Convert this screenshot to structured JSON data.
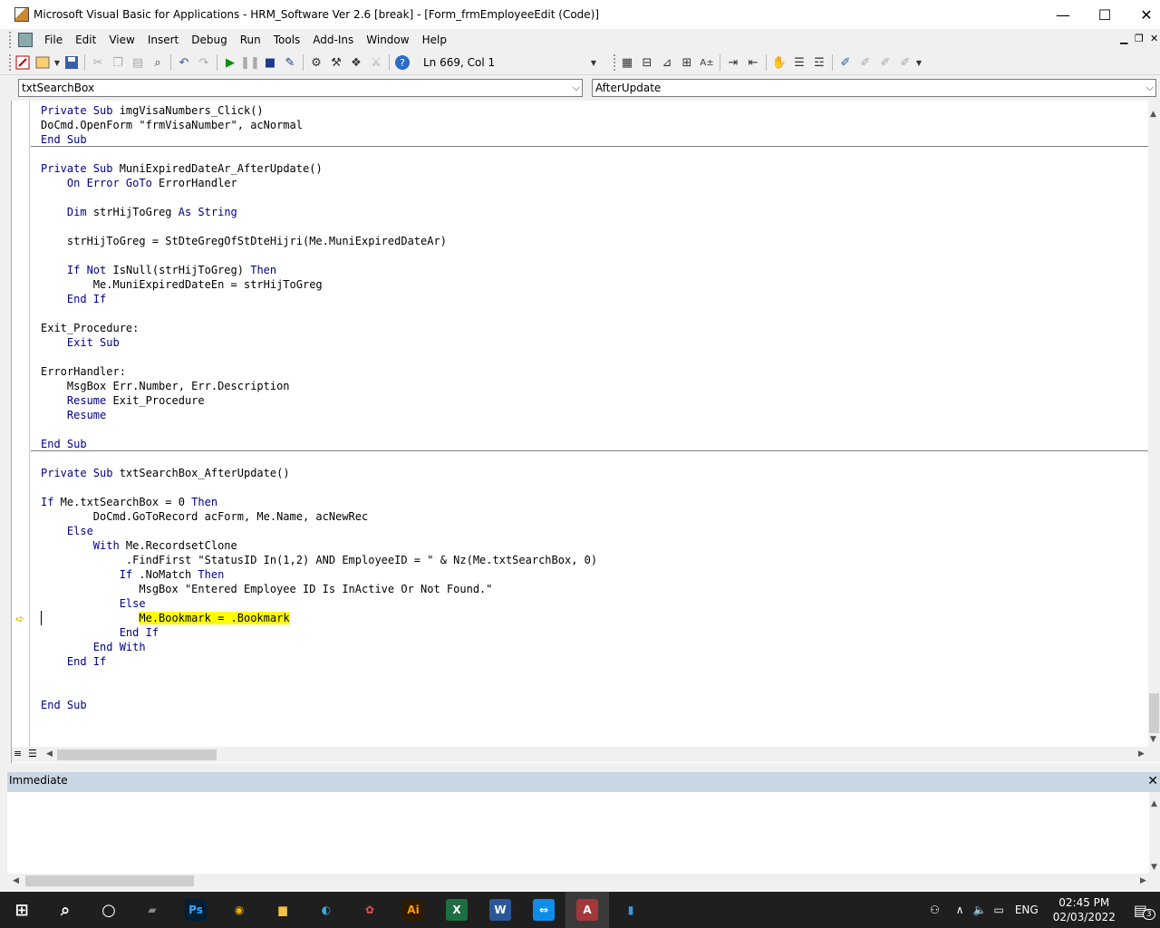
{
  "window": {
    "title": "Microsoft Visual Basic for Applications - HRM_Software Ver 2.6 [break] - [Form_frmEmployeeEdit (Code)]",
    "minimize_glyph": "—",
    "maximize_glyph": "☐",
    "close_glyph": "✕"
  },
  "menubar": {
    "items": [
      "File",
      "Edit",
      "View",
      "Insert",
      "Debug",
      "Run",
      "Tools",
      "Add-Ins",
      "Window",
      "Help"
    ],
    "mdi_min": "▁",
    "mdi_restore": "❐",
    "mdi_close": "✕"
  },
  "toolbar": {
    "position_text": "Ln 669, Col 1"
  },
  "combos": {
    "object": "txtSearchBox",
    "procedure": "AfterUpdate",
    "arrow": "⌵"
  },
  "code": {
    "lines": [
      [
        [
          "kw",
          "Private Sub"
        ],
        [
          "t",
          " imgVisaNumbers_Click()"
        ]
      ],
      [
        [
          "t",
          "DoCmd.OpenForm \"frmVisaNumber\", acNormal"
        ]
      ],
      [
        [
          "kw",
          "End Sub"
        ]
      ],
      [],
      [
        [
          "kw",
          "Private Sub"
        ],
        [
          "t",
          " MuniExpiredDateAr_AfterUpdate()"
        ]
      ],
      [
        [
          "t",
          "    "
        ],
        [
          "kw",
          "On Error GoTo"
        ],
        [
          "t",
          " ErrorHandler"
        ]
      ],
      [],
      [
        [
          "t",
          "    "
        ],
        [
          "kw",
          "Dim"
        ],
        [
          "t",
          " strHijToGreg "
        ],
        [
          "kw",
          "As String"
        ]
      ],
      [],
      [
        [
          "t",
          "    strHijToGreg = StDteGregOfStDteHijri(Me.MuniExpiredDateAr)"
        ]
      ],
      [],
      [
        [
          "t",
          "    "
        ],
        [
          "kw",
          "If Not"
        ],
        [
          "t",
          " IsNull(strHijToGreg) "
        ],
        [
          "kw",
          "Then"
        ]
      ],
      [
        [
          "t",
          "        Me.MuniExpiredDateEn = strHijToGreg"
        ]
      ],
      [
        [
          "t",
          "    "
        ],
        [
          "kw",
          "End If"
        ]
      ],
      [],
      [
        [
          "t",
          "Exit_Procedure:"
        ]
      ],
      [
        [
          "t",
          "    "
        ],
        [
          "kw",
          "Exit Sub"
        ]
      ],
      [],
      [
        [
          "t",
          "ErrorHandler:"
        ]
      ],
      [
        [
          "t",
          "    MsgBox Err.Number, Err.Description"
        ]
      ],
      [
        [
          "t",
          "    "
        ],
        [
          "kw",
          "Resume"
        ],
        [
          "t",
          " Exit_Procedure"
        ]
      ],
      [
        [
          "t",
          "    "
        ],
        [
          "kw",
          "Resume"
        ]
      ],
      [],
      [
        [
          "kw",
          "End Sub"
        ]
      ],
      [],
      [
        [
          "kw",
          "Private Sub"
        ],
        [
          "t",
          " txtSearchBox_AfterUpdate()"
        ]
      ],
      [],
      [
        [
          "kw",
          "If"
        ],
        [
          "t",
          " Me.txtSearchBox = 0 "
        ],
        [
          "kw",
          "Then"
        ]
      ],
      [
        [
          "t",
          "        DoCmd.GoToRecord acForm, Me.Name, acNewRec"
        ]
      ],
      [
        [
          "t",
          "    "
        ],
        [
          "kw",
          "Else"
        ]
      ],
      [
        [
          "t",
          "        "
        ],
        [
          "kw",
          "With"
        ],
        [
          "t",
          " Me.RecordsetClone"
        ]
      ],
      [
        [
          "t",
          "             .FindFirst \"StatusID In(1,2) AND EmployeeID = \" & Nz(Me.txtSearchBox, 0)"
        ]
      ],
      [
        [
          "t",
          "            "
        ],
        [
          "kw",
          "If"
        ],
        [
          "t",
          " .NoMatch "
        ],
        [
          "kw",
          "Then"
        ]
      ],
      [
        [
          "t",
          "               MsgBox \"Entered Employee ID Is InActive Or Not Found.\""
        ]
      ],
      [
        [
          "t",
          "            "
        ],
        [
          "kw",
          "Else"
        ]
      ],
      [
        [
          "t",
          "               "
        ],
        [
          "hl",
          "Me.Bookmark = .Bookmark"
        ]
      ],
      [
        [
          "t",
          "            "
        ],
        [
          "kw",
          "End If"
        ]
      ],
      [
        [
          "t",
          "        "
        ],
        [
          "kw",
          "End With"
        ]
      ],
      [
        [
          "t",
          "    "
        ],
        [
          "kw",
          "End If"
        ]
      ],
      [],
      [],
      [
        [
          "kw",
          "End Sub"
        ]
      ]
    ]
  },
  "immediate": {
    "title": "Immediate",
    "close_glyph": "✕"
  },
  "taskbar": {
    "apps": [
      {
        "name": "windows-start",
        "glyph": "⊞",
        "bg": "transparent",
        "color": "#ffffff"
      },
      {
        "name": "search",
        "glyph": "⌕",
        "bg": "transparent",
        "color": "#ffffff"
      },
      {
        "name": "cortana",
        "glyph": "○",
        "bg": "transparent",
        "color": "#ffffff"
      },
      {
        "name": "media",
        "glyph": "▰",
        "bg": "transparent",
        "color": "#888888"
      },
      {
        "name": "photoshop",
        "glyph": "Ps",
        "bg": "#001e36",
        "color": "#31a8ff"
      },
      {
        "name": "chrome",
        "glyph": "◉",
        "bg": "transparent",
        "color": "#e8b400"
      },
      {
        "name": "file-explorer",
        "glyph": "▆",
        "bg": "transparent",
        "color": "#f5c242"
      },
      {
        "name": "edge",
        "glyph": "◐",
        "bg": "transparent",
        "color": "#2fb5e8"
      },
      {
        "name": "paint",
        "glyph": "✿",
        "bg": "transparent",
        "color": "#e05050"
      },
      {
        "name": "illustrator",
        "glyph": "Ai",
        "bg": "#2e1b00",
        "color": "#ff9a00"
      },
      {
        "name": "excel",
        "glyph": "X",
        "bg": "#1d6f42",
        "color": "#ffffff"
      },
      {
        "name": "word",
        "glyph": "W",
        "bg": "#2b579a",
        "color": "#ffffff"
      },
      {
        "name": "teamviewer",
        "glyph": "⇔",
        "bg": "#0e8ee9",
        "color": "#ffffff"
      },
      {
        "name": "access",
        "glyph": "A",
        "bg": "#a4373a",
        "color": "#ffffff"
      },
      {
        "name": "device",
        "glyph": "▮",
        "bg": "transparent",
        "color": "#3a9ae8"
      }
    ],
    "tray": {
      "people_glyph": "⚇",
      "up_glyph": "∧",
      "volume_glyph": "🔈",
      "network_glyph": "▭",
      "language": "ENG",
      "time": "02:45 PM",
      "date": "02/03/2022",
      "notif_glyph": "▤",
      "notif_count": "3"
    }
  }
}
